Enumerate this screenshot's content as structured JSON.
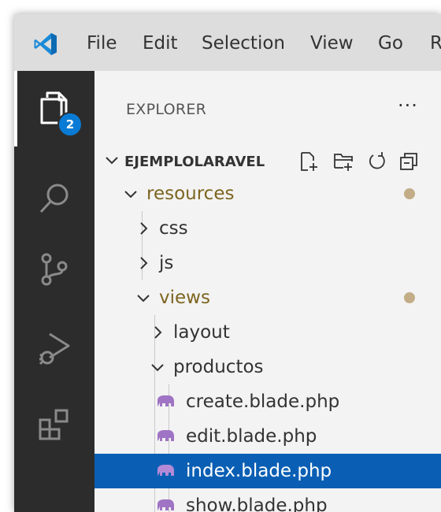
{
  "menu": {
    "items": [
      "File",
      "Edit",
      "Selection",
      "View",
      "Go",
      "R"
    ]
  },
  "activity_bar": {
    "icons": [
      "explorer-icon",
      "search-icon",
      "source-control-icon",
      "run-debug-icon",
      "extensions-icon"
    ],
    "explorer_badge": "2"
  },
  "explorer": {
    "title": "EXPLORER",
    "more_label": "···",
    "folder_name": "EJEMPLOLARAVEL",
    "toolbar_icons": [
      "new-file-icon",
      "new-folder-icon",
      "refresh-icon",
      "collapse-all-icon"
    ],
    "tree": [
      {
        "label": "resources",
        "type": "folder",
        "expanded": true,
        "modified": true
      },
      {
        "label": "css",
        "type": "folder",
        "expanded": false
      },
      {
        "label": "js",
        "type": "folder",
        "expanded": false
      },
      {
        "label": "views",
        "type": "folder",
        "expanded": true,
        "modified": true
      },
      {
        "label": "layout",
        "type": "folder",
        "expanded": false
      },
      {
        "label": "productos",
        "type": "folder",
        "expanded": true
      },
      {
        "label": "create.blade.php",
        "type": "file"
      },
      {
        "label": "edit.blade.php",
        "type": "file"
      },
      {
        "label": "index.blade.php",
        "type": "file",
        "selected": true
      },
      {
        "label": "show.blade.php",
        "type": "file"
      }
    ]
  },
  "colors": {
    "activity_bar": "#2c2c2c",
    "badge": "#0a7bd5",
    "selection": "#0a5fb4",
    "modified_text": "#7d6520",
    "modified_dot": "#c2ad87",
    "php_icon": "#a074c4"
  }
}
